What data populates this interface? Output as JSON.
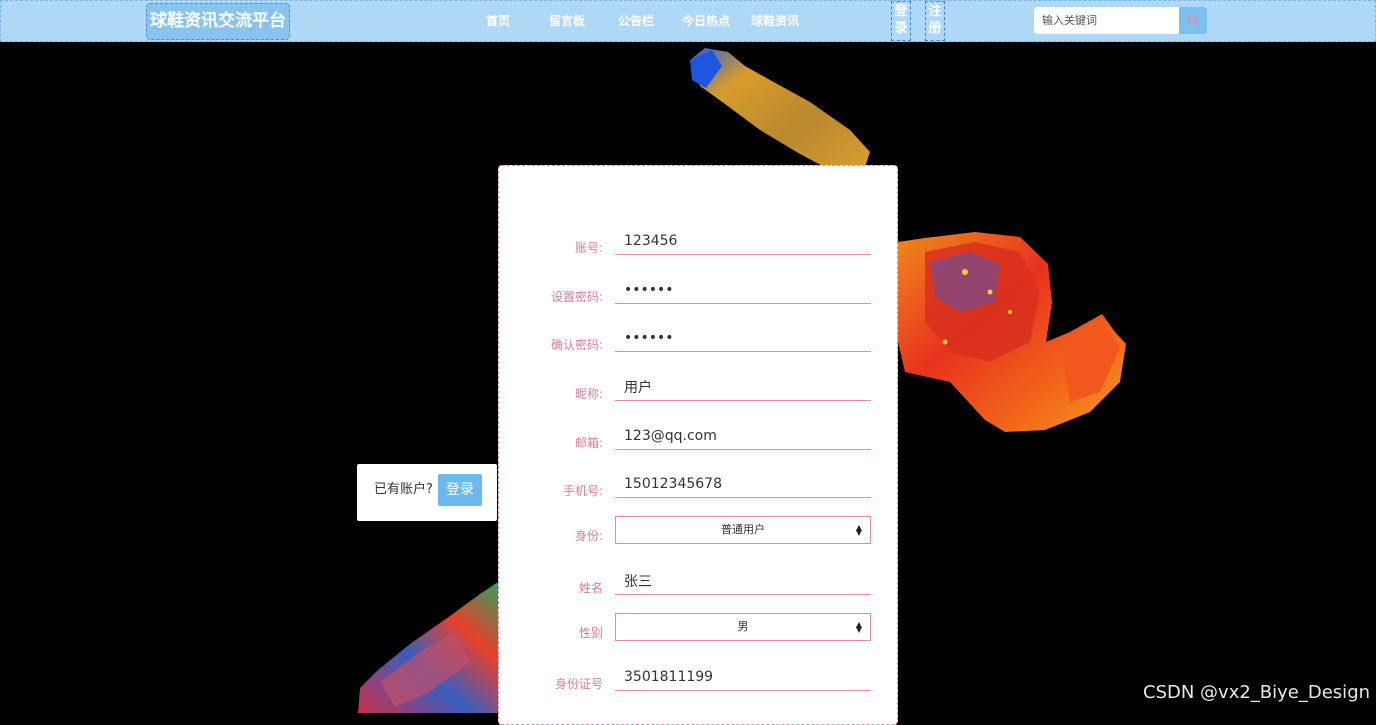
{
  "site": {
    "logo": "球鞋资讯交流平台"
  },
  "nav": {
    "links": [
      "首页",
      "留言板",
      "公告栏",
      "今日热点",
      "球鞋资讯"
    ],
    "login": "登录",
    "register": "注册"
  },
  "search": {
    "placeholder": "输入关键词",
    "icon": "search-icon"
  },
  "login_prompt": {
    "text": "已有账户?",
    "button": "登录"
  },
  "form": {
    "fields": [
      {
        "label": "账号:",
        "value": "123456",
        "type": "text"
      },
      {
        "label": "设置密码:",
        "value": "123456",
        "type": "password"
      },
      {
        "label": "确认密码:",
        "value": "123456",
        "type": "password"
      },
      {
        "label": "昵称:",
        "value": "用户",
        "type": "text"
      },
      {
        "label": "邮箱:",
        "value": "123@qq.com",
        "type": "text"
      },
      {
        "label": "手机号:",
        "value": "15012345678",
        "type": "text"
      },
      {
        "label": "身份:",
        "value": "普通用户",
        "type": "select"
      },
      {
        "label": "姓名",
        "value": "张三",
        "type": "text"
      },
      {
        "label": "性别",
        "value": "男",
        "type": "select"
      },
      {
        "label": "身份证号",
        "value": "3501811199",
        "type": "text"
      }
    ]
  },
  "watermark": "CSDN @vx2_Biye_Design",
  "colors": {
    "topbar": "#aed8f5",
    "accent": "#6bb9ef",
    "form_accent": "#e58ba6",
    "label": "#e07a9a"
  }
}
